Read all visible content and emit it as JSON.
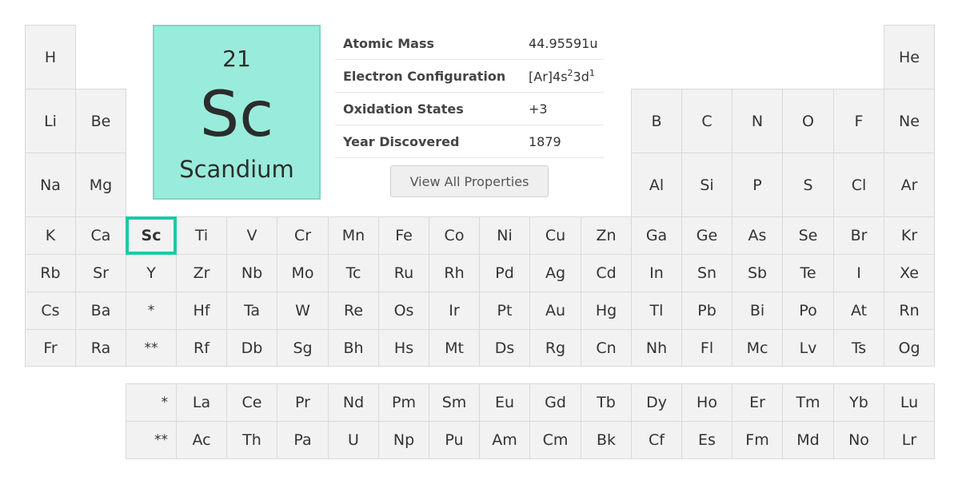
{
  "colors": {
    "card_bg": "#99ecdb",
    "accent": "#1dc9a4",
    "cell_bg": "#f2f2f2",
    "cell_border": "#d9d9d9"
  },
  "selected_element": {
    "number": "21",
    "symbol": "Sc",
    "name": "Scandium",
    "properties": [
      {
        "label": "Atomic Mass",
        "value": "44.95591u"
      },
      {
        "label": "Electron Configuration",
        "value_parts": [
          "[Ar]4s",
          "2",
          "3d",
          "1"
        ]
      },
      {
        "label": "Oxidation States",
        "value": "+3"
      },
      {
        "label": "Year Discovered",
        "value": "1879"
      }
    ],
    "view_all_label": "View All Properties"
  },
  "periods": [
    [
      "H",
      "",
      "",
      "",
      "",
      "",
      "",
      "",
      "",
      "",
      "",
      "",
      "",
      "",
      "",
      "",
      "",
      "He"
    ],
    [
      "Li",
      "Be",
      "",
      "",
      "",
      "",
      "",
      "",
      "",
      "",
      "",
      "",
      "B",
      "C",
      "N",
      "O",
      "F",
      "Ne"
    ],
    [
      "Na",
      "Mg",
      "",
      "",
      "",
      "",
      "",
      "",
      "",
      "",
      "",
      "",
      "Al",
      "Si",
      "P",
      "S",
      "Cl",
      "Ar"
    ],
    [
      "K",
      "Ca",
      "Sc",
      "Ti",
      "V",
      "Cr",
      "Mn",
      "Fe",
      "Co",
      "Ni",
      "Cu",
      "Zn",
      "Ga",
      "Ge",
      "As",
      "Se",
      "Br",
      "Kr"
    ],
    [
      "Rb",
      "Sr",
      "Y",
      "Zr",
      "Nb",
      "Mo",
      "Tc",
      "Ru",
      "Rh",
      "Pd",
      "Ag",
      "Cd",
      "In",
      "Sn",
      "Sb",
      "Te",
      "I",
      "Xe"
    ],
    [
      "Cs",
      "Ba",
      "*",
      "Hf",
      "Ta",
      "W",
      "Re",
      "Os",
      "Ir",
      "Pt",
      "Au",
      "Hg",
      "Tl",
      "Pb",
      "Bi",
      "Po",
      "At",
      "Rn"
    ],
    [
      "Fr",
      "Ra",
      "**",
      "Rf",
      "Db",
      "Sg",
      "Bh",
      "Hs",
      "Mt",
      "Ds",
      "Rg",
      "Cn",
      "Nh",
      "Fl",
      "Mc",
      "Lv",
      "Ts",
      "Og"
    ]
  ],
  "f_block": [
    [
      "*",
      "La",
      "Ce",
      "Pr",
      "Nd",
      "Pm",
      "Sm",
      "Eu",
      "Gd",
      "Tb",
      "Dy",
      "Ho",
      "Er",
      "Tm",
      "Yb",
      "Lu"
    ],
    [
      "**",
      "Ac",
      "Th",
      "Pa",
      "U",
      "Np",
      "Pu",
      "Am",
      "Cm",
      "Bk",
      "Cf",
      "Es",
      "Fm",
      "Md",
      "No",
      "Lr"
    ]
  ]
}
